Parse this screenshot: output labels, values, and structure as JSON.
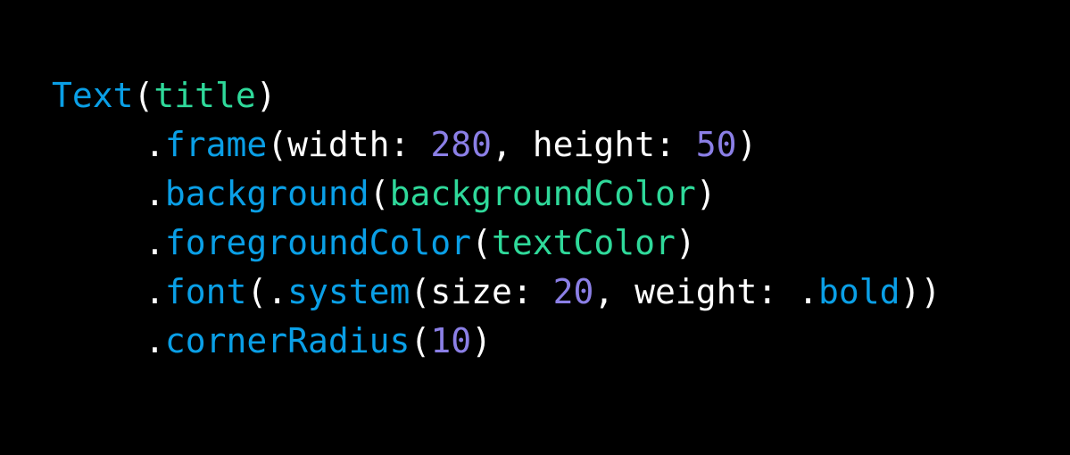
{
  "colors": {
    "background": "#000000",
    "plain": "#ffffff",
    "type": "#0a9fe6",
    "method": "#0a9fe6",
    "variable": "#2fd99a",
    "number": "#8b7fe6"
  },
  "code_lines": [
    {
      "indent": false,
      "tokens": [
        {
          "text": "Text",
          "kind": "type"
        },
        {
          "text": "(",
          "kind": "plain"
        },
        {
          "text": "title",
          "kind": "variable"
        },
        {
          "text": ")",
          "kind": "plain"
        }
      ]
    },
    {
      "indent": true,
      "tokens": [
        {
          "text": ".",
          "kind": "plain"
        },
        {
          "text": "frame",
          "kind": "method"
        },
        {
          "text": "(width: ",
          "kind": "plain"
        },
        {
          "text": "280",
          "kind": "number"
        },
        {
          "text": ", height: ",
          "kind": "plain"
        },
        {
          "text": "50",
          "kind": "number"
        },
        {
          "text": ")",
          "kind": "plain"
        }
      ]
    },
    {
      "indent": true,
      "tokens": [
        {
          "text": ".",
          "kind": "plain"
        },
        {
          "text": "background",
          "kind": "method"
        },
        {
          "text": "(",
          "kind": "plain"
        },
        {
          "text": "backgroundColor",
          "kind": "variable"
        },
        {
          "text": ")",
          "kind": "plain"
        }
      ]
    },
    {
      "indent": true,
      "tokens": [
        {
          "text": ".",
          "kind": "plain"
        },
        {
          "text": "foregroundColor",
          "kind": "method"
        },
        {
          "text": "(",
          "kind": "plain"
        },
        {
          "text": "textColor",
          "kind": "variable"
        },
        {
          "text": ")",
          "kind": "plain"
        }
      ]
    },
    {
      "indent": true,
      "tokens": [
        {
          "text": ".",
          "kind": "plain"
        },
        {
          "text": "font",
          "kind": "method"
        },
        {
          "text": "(.",
          "kind": "plain"
        },
        {
          "text": "system",
          "kind": "method"
        },
        {
          "text": "(size: ",
          "kind": "plain"
        },
        {
          "text": "20",
          "kind": "number"
        },
        {
          "text": ", weight: .",
          "kind": "plain"
        },
        {
          "text": "bold",
          "kind": "method"
        },
        {
          "text": "))",
          "kind": "plain"
        }
      ]
    },
    {
      "indent": true,
      "tokens": [
        {
          "text": ".",
          "kind": "plain"
        },
        {
          "text": "cornerRadius",
          "kind": "method"
        },
        {
          "text": "(",
          "kind": "plain"
        },
        {
          "text": "10",
          "kind": "number"
        },
        {
          "text": ")",
          "kind": "plain"
        }
      ]
    }
  ]
}
